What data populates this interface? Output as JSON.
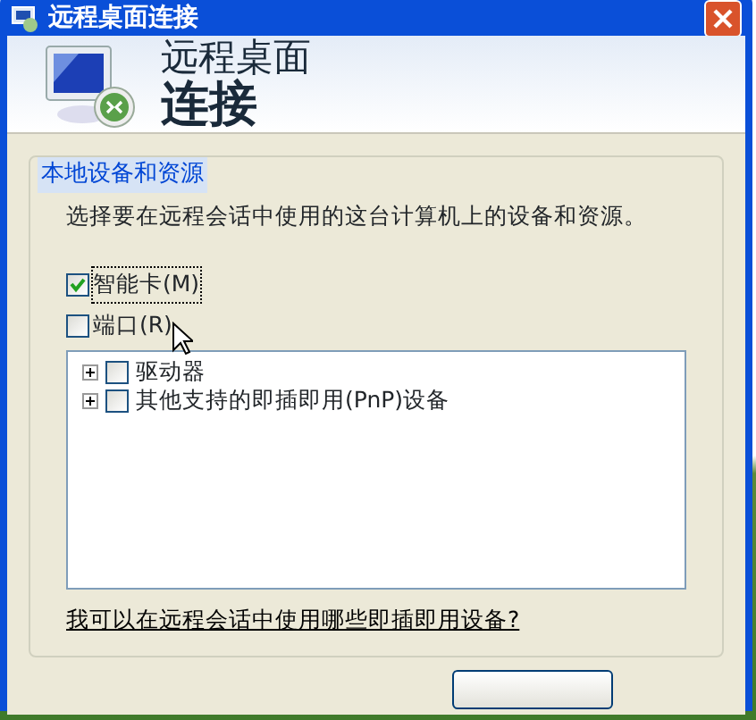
{
  "window": {
    "title": "远程桌面连接"
  },
  "header": {
    "line_1": "远程桌面",
    "line_2": "连接"
  },
  "group": {
    "title": "本地设备和资源",
    "description": "选择要在远程会话中使用的这台计算机上的设备和资源。",
    "options": [
      {
        "label": "智能卡(M)",
        "checked": true,
        "focused": true
      },
      {
        "label": "端口(R)",
        "checked": false,
        "focused": false
      }
    ],
    "devices": [
      {
        "label": "驱动器",
        "expanded": false,
        "checked": false
      },
      {
        "label": "其他支持的即插即用(PnP)设备",
        "expanded": false,
        "checked": false
      }
    ],
    "link": "我可以在远程会话中使用哪些即插即用设备?"
  }
}
